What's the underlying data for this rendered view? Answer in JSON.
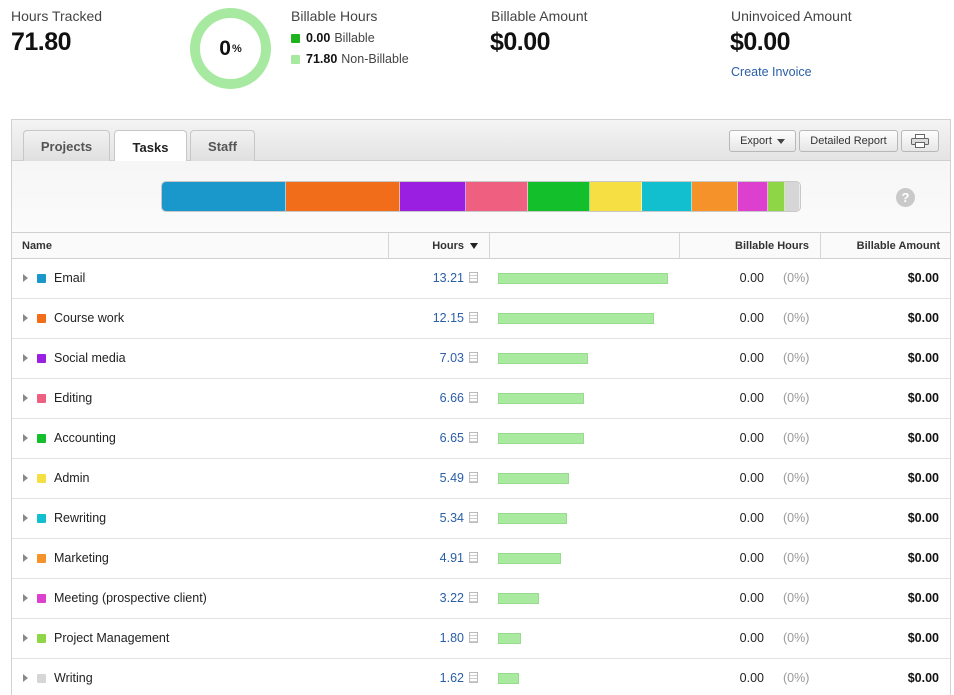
{
  "summary": {
    "hours_tracked_label": "Hours Tracked",
    "hours_tracked_value": "71.80",
    "billable_percent": "0",
    "billable_percent_unit": "%",
    "billable_hours_label": "Billable Hours",
    "billable_value": "0.00",
    "billable_text": "Billable",
    "billable_color": "#1db31d",
    "non_billable_value": "71.80",
    "non_billable_text": "Non-Billable",
    "non_billable_color": "#a7e9a1",
    "billable_amount_label": "Billable Amount",
    "billable_amount_value": "$0.00",
    "uninvoiced_label": "Uninvoiced Amount",
    "uninvoiced_value": "$0.00",
    "create_invoice_link": "Create Invoice"
  },
  "tabs": [
    {
      "label": "Projects",
      "active": false
    },
    {
      "label": "Tasks",
      "active": true
    },
    {
      "label": "Staff",
      "active": false
    }
  ],
  "toolbar": {
    "export_label": "Export",
    "detailed_report_label": "Detailed Report",
    "print_icon": "print-icon",
    "help_icon": "?"
  },
  "columns": {
    "name": "Name",
    "hours": "Hours",
    "billable_hours": "Billable Hours",
    "billable_amount": "Billable Amount"
  },
  "tasks": [
    {
      "name": "Email",
      "hours": "13.21",
      "billable": "0.00",
      "pct": "(0%)",
      "amount": "$0.00",
      "color": "#1a98cc"
    },
    {
      "name": "Course work",
      "hours": "12.15",
      "billable": "0.00",
      "pct": "(0%)",
      "amount": "$0.00",
      "color": "#f26d1a"
    },
    {
      "name": "Social media",
      "hours": "7.03",
      "billable": "0.00",
      "pct": "(0%)",
      "amount": "$0.00",
      "color": "#9b1fe0"
    },
    {
      "name": "Editing",
      "hours": "6.66",
      "billable": "0.00",
      "pct": "(0%)",
      "amount": "$0.00",
      "color": "#ef5f80"
    },
    {
      "name": "Accounting",
      "hours": "6.65",
      "billable": "0.00",
      "pct": "(0%)",
      "amount": "$0.00",
      "color": "#13c02c"
    },
    {
      "name": "Admin",
      "hours": "5.49",
      "billable": "0.00",
      "pct": "(0%)",
      "amount": "$0.00",
      "color": "#f5df43"
    },
    {
      "name": "Rewriting",
      "hours": "5.34",
      "billable": "0.00",
      "pct": "(0%)",
      "amount": "$0.00",
      "color": "#12bfcf"
    },
    {
      "name": "Marketing",
      "hours": "4.91",
      "billable": "0.00",
      "pct": "(0%)",
      "amount": "$0.00",
      "color": "#f5922a"
    },
    {
      "name": "Meeting (prospective client)",
      "hours": "3.22",
      "billable": "0.00",
      "pct": "(0%)",
      "amount": "$0.00",
      "color": "#dd3fcf"
    },
    {
      "name": "Project Management",
      "hours": "1.80",
      "billable": "0.00",
      "pct": "(0%)",
      "amount": "$0.00",
      "color": "#8fd647"
    },
    {
      "name": "Writing",
      "hours": "1.62",
      "billable": "0.00",
      "pct": "(0%)",
      "amount": "$0.00",
      "color": "#d6d6d6"
    }
  ]
}
